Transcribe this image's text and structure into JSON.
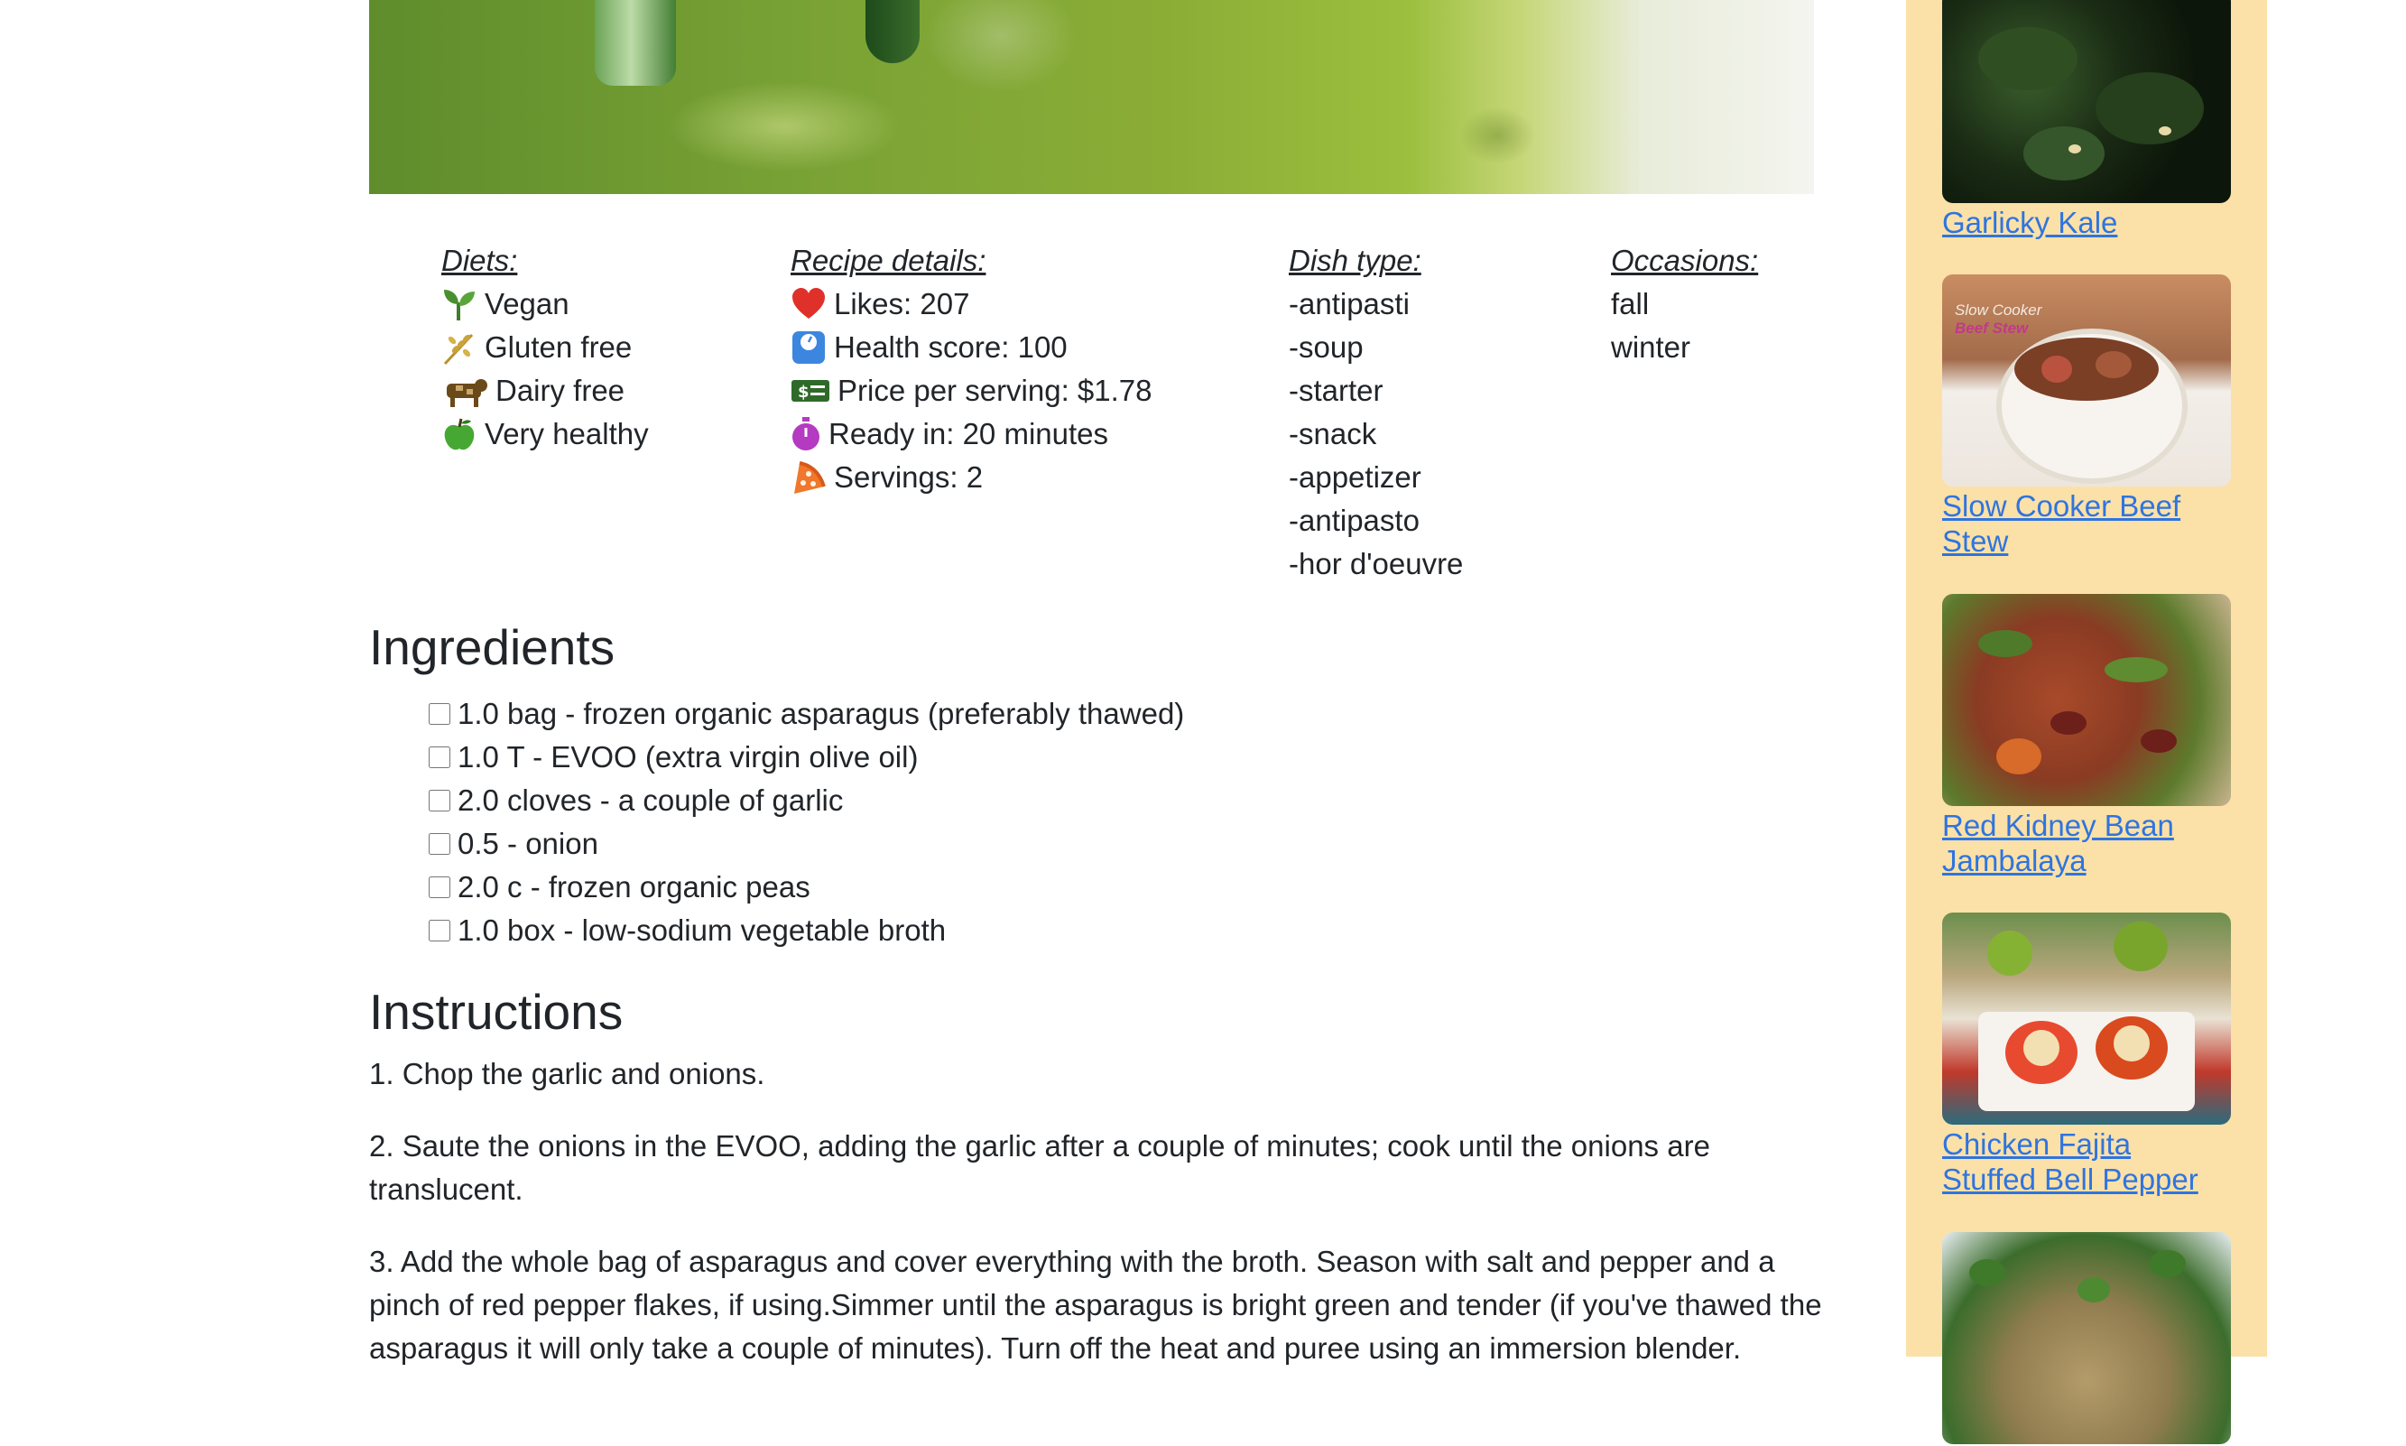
{
  "recipe": {
    "diets": {
      "title": "Diets:",
      "items": [
        {
          "label": "Vegan",
          "icon": "seedling-icon"
        },
        {
          "label": "Gluten free",
          "icon": "wheat-icon"
        },
        {
          "label": "Dairy free",
          "icon": "cow-icon"
        },
        {
          "label": "Very healthy",
          "icon": "apple-icon"
        }
      ]
    },
    "details": {
      "title": "Recipe details:",
      "items": [
        {
          "label": "Likes: 207",
          "icon": "heart-icon"
        },
        {
          "label": "Health score: 100",
          "icon": "scale-icon"
        },
        {
          "label": "Price per serving: $1.78",
          "icon": "money-icon"
        },
        {
          "label": "Ready in: 20 minutes",
          "icon": "stopwatch-icon"
        },
        {
          "label": "Servings: 2",
          "icon": "pizza-slice-icon"
        }
      ]
    },
    "dish_type": {
      "title": "Dish type:",
      "items": [
        "-antipasti",
        "-soup",
        "-starter",
        "-snack",
        "-appetizer",
        "-antipasto",
        "-hor d'oeuvre"
      ]
    },
    "occasions": {
      "title": "Occasions:",
      "items": [
        "fall",
        "winter"
      ]
    },
    "ingredients": {
      "title": "Ingredients",
      "items": [
        "1.0 bag - frozen organic asparagus (preferably thawed)",
        "1.0 T - EVOO (extra virgin olive oil)",
        "2.0 cloves - a couple of garlic",
        "0.5 - onion",
        "2.0 c - frozen organic peas",
        "1.0 box - low-sodium vegetable broth"
      ]
    },
    "instructions": {
      "title": "Instructions",
      "steps": [
        "1. Chop the garlic and onions.",
        "2. Saute the onions in the EVOO, adding the garlic after a couple of minutes; cook until the onions are translucent.",
        "3. Add the whole bag of asparagus and cover everything with the broth. Season with salt and pepper and a pinch of red pepper flakes, if using.Simmer until the asparagus is bright green and tender (if you've thawed the asparagus it will only take a couple of minutes). Turn off the heat and puree using an immersion blender."
      ]
    }
  },
  "sidebar": {
    "related": [
      {
        "title": "Garlicky Kale"
      },
      {
        "title": "Slow Cooker Beef Stew",
        "image_text": [
          "Slow Cooker",
          "Beef Stew"
        ]
      },
      {
        "title": "Red Kidney Bean Jambalaya"
      },
      {
        "title": "Chicken Fajita Stuffed Bell Pepper"
      },
      {
        "title": ""
      }
    ]
  },
  "colors": {
    "sidebar_bg": "#fbe1a7",
    "link": "#2f74e0",
    "text": "#212529"
  }
}
